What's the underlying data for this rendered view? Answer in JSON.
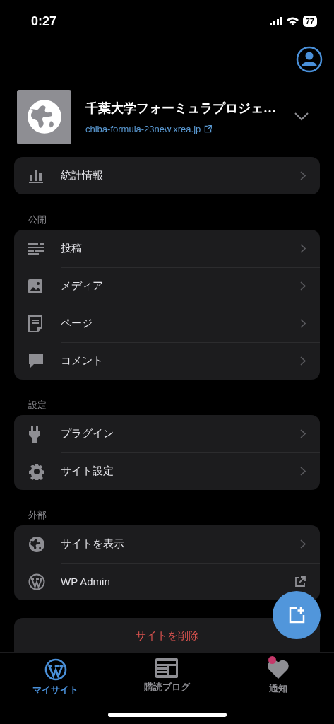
{
  "status_bar": {
    "time": "0:27",
    "battery": "77"
  },
  "site": {
    "title": "千葉大学フォーミュラプロジェ…",
    "url": "chiba-formula-23new.xrea.jp"
  },
  "stats": {
    "label": "統計情報"
  },
  "sections": [
    {
      "title": "公開",
      "items": [
        {
          "label": "投稿",
          "kind": "chevron"
        },
        {
          "label": "メディア",
          "kind": "chevron"
        },
        {
          "label": "ページ",
          "kind": "chevron"
        },
        {
          "label": "コメント",
          "kind": "chevron"
        }
      ]
    },
    {
      "title": "設定",
      "items": [
        {
          "label": "プラグイン",
          "kind": "chevron"
        },
        {
          "label": "サイト設定",
          "kind": "chevron"
        }
      ]
    },
    {
      "title": "外部",
      "items": [
        {
          "label": "サイトを表示",
          "kind": "chevron"
        },
        {
          "label": "WP Admin",
          "kind": "external"
        }
      ]
    }
  ],
  "delete_button": "サイトを削除",
  "tabs": [
    {
      "label": "マイサイト",
      "selected": true,
      "unread": false
    },
    {
      "label": "購読ブログ",
      "selected": false,
      "unread": false
    },
    {
      "label": "通知",
      "selected": false,
      "unread": true
    }
  ]
}
